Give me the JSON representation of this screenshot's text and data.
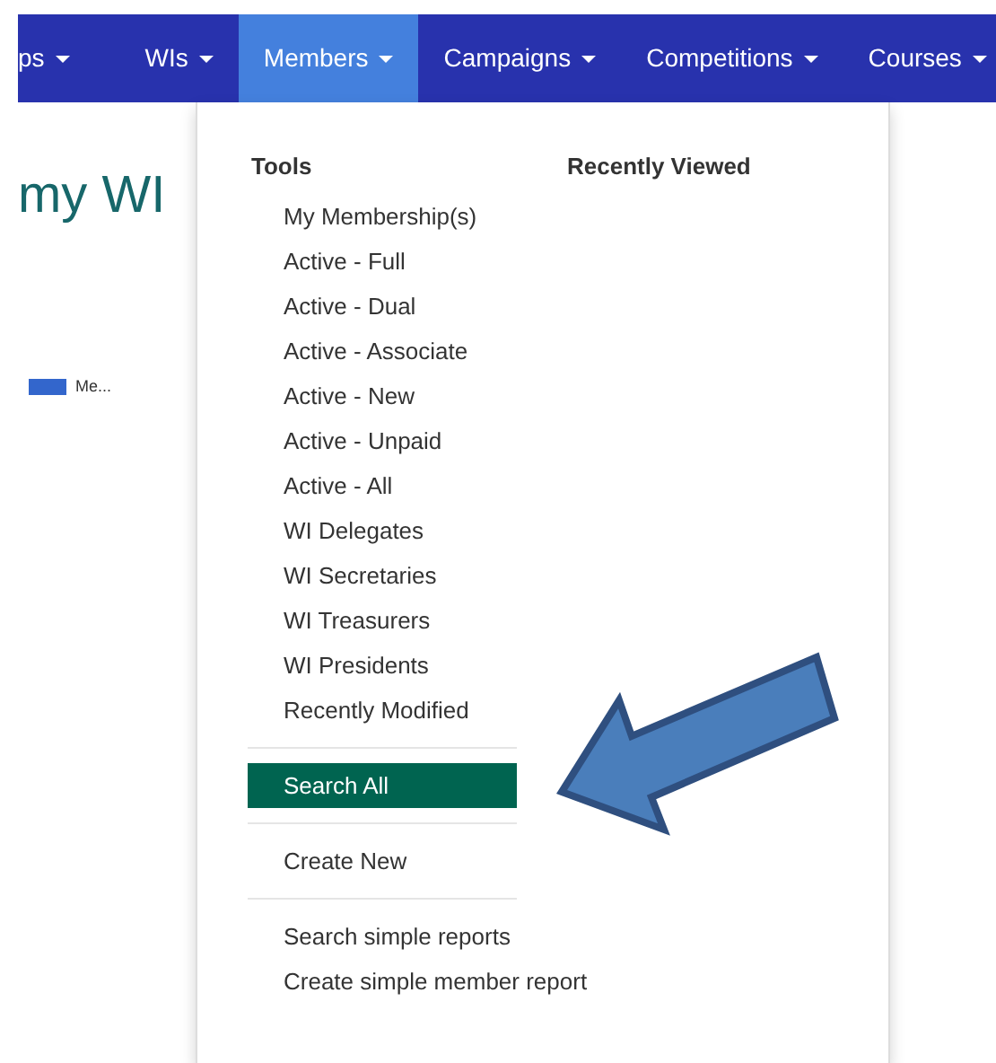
{
  "nav": {
    "items": [
      {
        "label": "ps",
        "selected": false
      },
      {
        "label": "WIs",
        "selected": false
      },
      {
        "label": "Members",
        "selected": true
      },
      {
        "label": "Campaigns",
        "selected": false
      },
      {
        "label": "Competitions",
        "selected": false
      },
      {
        "label": "Courses",
        "selected": false
      }
    ]
  },
  "page": {
    "heading": "my WI",
    "legend": {
      "label": "Me...",
      "color": "#3366cc"
    }
  },
  "dropdown": {
    "columns": [
      "Tools",
      "Recently Viewed"
    ],
    "groups": [
      {
        "items": [
          {
            "label": "My Membership(s)",
            "selected": false
          },
          {
            "label": "Active - Full",
            "selected": false
          },
          {
            "label": "Active - Dual",
            "selected": false
          },
          {
            "label": "Active - Associate",
            "selected": false
          },
          {
            "label": "Active - New",
            "selected": false
          },
          {
            "label": "Active - Unpaid",
            "selected": false
          },
          {
            "label": "Active - All",
            "selected": false
          },
          {
            "label": "WI Delegates",
            "selected": false
          },
          {
            "label": "WI Secretaries",
            "selected": false
          },
          {
            "label": "WI Treasurers",
            "selected": false
          },
          {
            "label": "WI Presidents",
            "selected": false
          },
          {
            "label": "Recently Modified",
            "selected": false
          }
        ]
      },
      {
        "items": [
          {
            "label": "Search All",
            "selected": true
          }
        ]
      },
      {
        "items": [
          {
            "label": "Create New",
            "selected": false
          }
        ]
      },
      {
        "items": [
          {
            "label": "Search simple reports",
            "selected": false
          },
          {
            "label": "Create simple member report",
            "selected": false
          }
        ]
      }
    ]
  }
}
